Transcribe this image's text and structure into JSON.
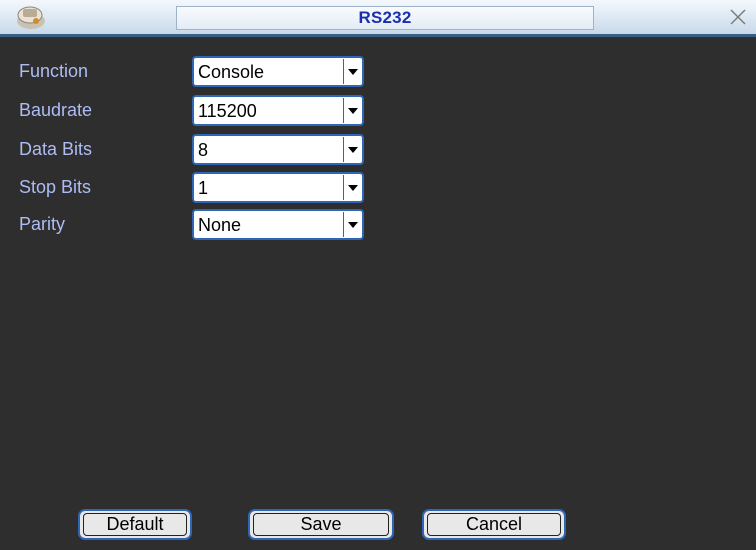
{
  "window": {
    "title": "RS232"
  },
  "fields": [
    {
      "label": "Function",
      "value": "Console"
    },
    {
      "label": "Baudrate",
      "value": "115200"
    },
    {
      "label": "Data Bits",
      "value": "8"
    },
    {
      "label": "Stop Bits",
      "value": "1"
    },
    {
      "label": "Parity",
      "value": "None"
    }
  ],
  "buttons": {
    "default_label": "Default",
    "save_label": "Save",
    "cancel_label": "Cancel"
  },
  "colors": {
    "background": "#2e2e2e",
    "label_text": "#aebcf4",
    "accent_border": "#2f67b6",
    "title_text": "#1b2fae"
  }
}
